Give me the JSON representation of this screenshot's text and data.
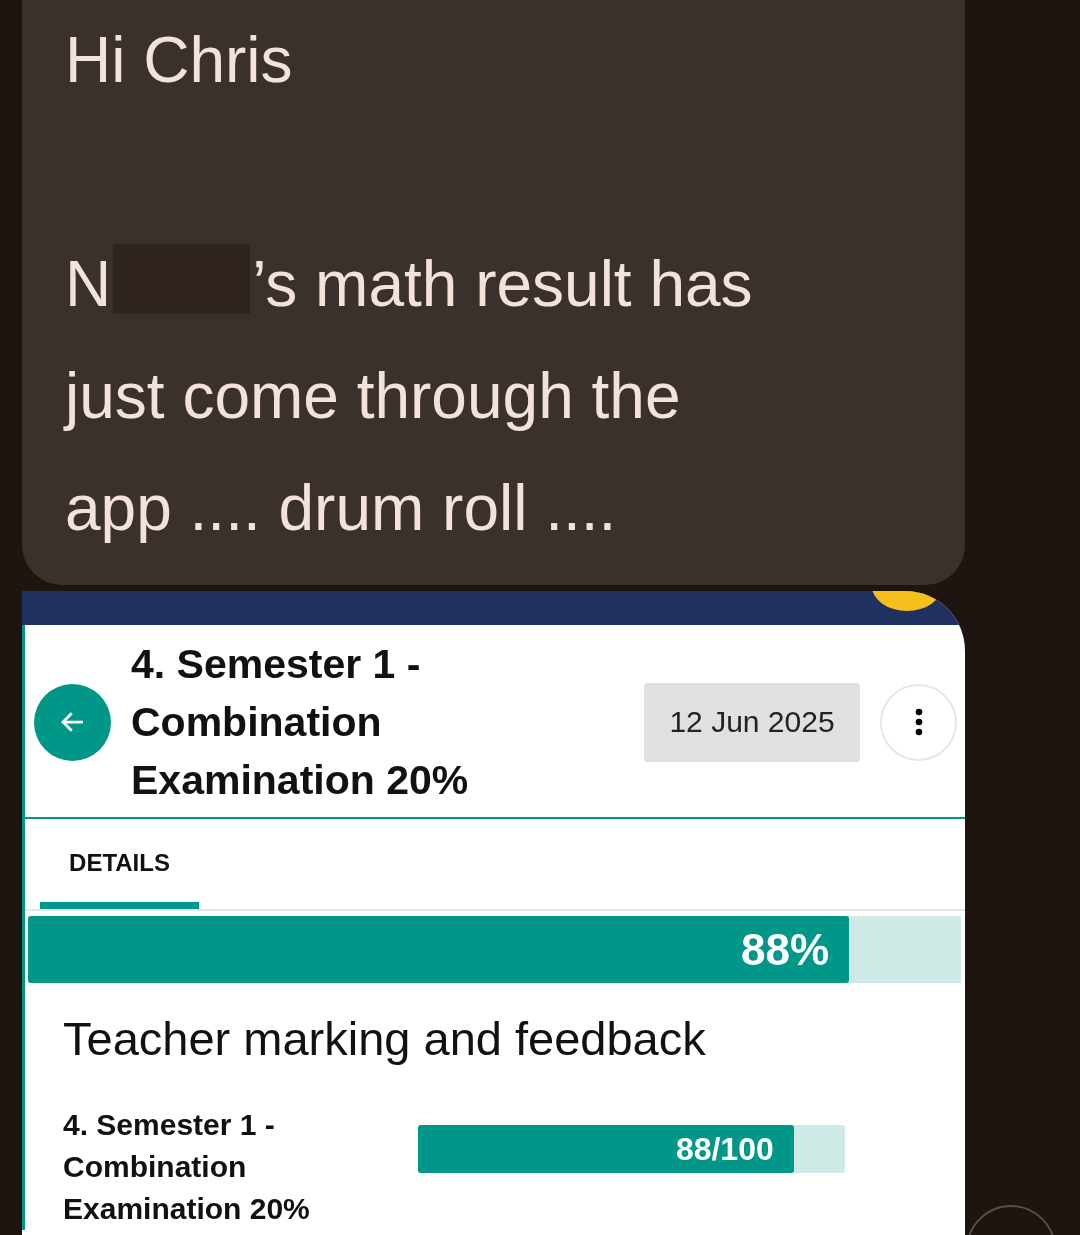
{
  "message": {
    "greeting": "Hi Chris",
    "body_start": "N",
    "redacted": true,
    "body_lines": [
      "’s math result has",
      "just come through the",
      "app .... drum roll ...."
    ]
  },
  "result": {
    "title": "4. Semester 1 - Combination Examination 20%",
    "date": "12 Jun 2025",
    "tabs": [
      {
        "label": "DETAILS",
        "selected": true
      }
    ],
    "overall": {
      "level": 0.88,
      "reading": "88%"
    },
    "section_title": "Teacher marking and feedback",
    "items": [
      {
        "name": "4. Semester 1 - Combination Examination 20%",
        "level": 0.88,
        "reading": "88/100"
      }
    ]
  }
}
